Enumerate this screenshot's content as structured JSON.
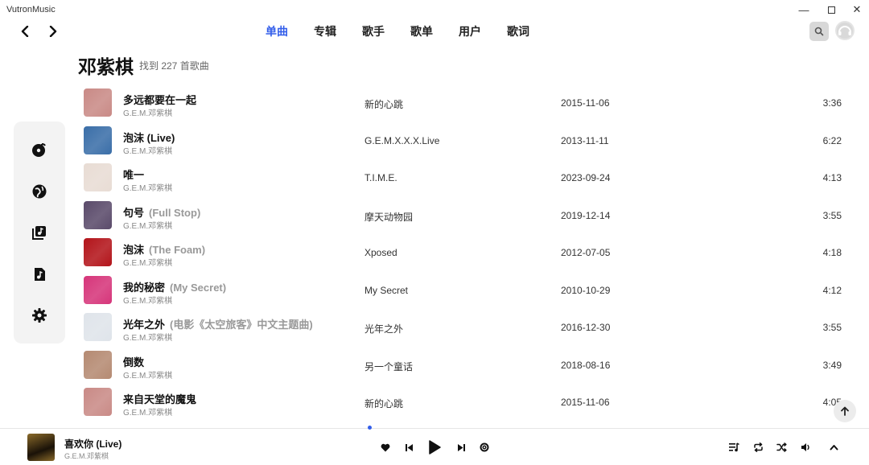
{
  "app": {
    "title": "VutronMusic",
    "window_controls": {
      "minimize": "—",
      "maximize_icon": "maximize-icon",
      "close": "✕"
    }
  },
  "nav": {
    "back_icon": "chevron-left-icon",
    "forward_icon": "chevron-right-icon"
  },
  "tabs": [
    {
      "label": "单曲",
      "active": true
    },
    {
      "label": "专辑",
      "active": false
    },
    {
      "label": "歌手",
      "active": false
    },
    {
      "label": "歌单",
      "active": false
    },
    {
      "label": "用户",
      "active": false
    },
    {
      "label": "歌词",
      "active": false
    }
  ],
  "header": {
    "search_icon": "search-icon",
    "avatar_icon": "user-avatar-icon"
  },
  "page": {
    "artist": "邓紫棋",
    "result_count": "找到 227 首歌曲"
  },
  "sidebar": {
    "items": [
      {
        "icon": "music-disc-icon"
      },
      {
        "icon": "explore-globe-icon"
      },
      {
        "icon": "library-icon"
      },
      {
        "icon": "music-folder-icon"
      },
      {
        "icon": "settings-gear-icon"
      }
    ]
  },
  "songs": [
    {
      "title": "多远都要在一起",
      "subtitle": "",
      "artist": "G.E.M.邓紫棋",
      "album": "新的心跳",
      "date": "2015-11-06",
      "duration": "3:36",
      "cover_color": "#c98a86"
    },
    {
      "title": "泡沫 (Live)",
      "subtitle": "",
      "artist": "G.E.M.邓紫棋",
      "album": "G.E.M.X.X.X.Live",
      "date": "2013-11-11",
      "duration": "6:22",
      "cover_color": "#3a6ea8"
    },
    {
      "title": "唯一",
      "subtitle": "",
      "artist": "G.E.M.邓紫棋",
      "album": "T.I.M.E.",
      "date": "2023-09-24",
      "duration": "4:13",
      "cover_color": "#e8dcd4"
    },
    {
      "title": "句号",
      "subtitle": "(Full Stop)",
      "artist": "G.E.M.邓紫棋",
      "album": "摩天动物园",
      "date": "2019-12-14",
      "duration": "3:55",
      "cover_color": "#5a4a6a"
    },
    {
      "title": "泡沫",
      "subtitle": "(The Foam)",
      "artist": "G.E.M.邓紫棋",
      "album": "Xposed",
      "date": "2012-07-05",
      "duration": "4:18",
      "cover_color": "#b3141a"
    },
    {
      "title": "我的秘密",
      "subtitle": "(My Secret)",
      "artist": "G.E.M.邓紫棋",
      "album": "My Secret",
      "date": "2010-10-29",
      "duration": "4:12",
      "cover_color": "#d6357a"
    },
    {
      "title": "光年之外",
      "subtitle": "(电影《太空旅客》中文主题曲)",
      "artist": "G.E.M.邓紫棋",
      "album": "光年之外",
      "date": "2016-12-30",
      "duration": "3:55",
      "cover_color": "#dfe4ea"
    },
    {
      "title": "倒数",
      "subtitle": "",
      "artist": "G.E.M.邓紫棋",
      "album": "另一个童话",
      "date": "2018-08-16",
      "duration": "3:49",
      "cover_color": "#b58a72"
    },
    {
      "title": "来自天堂的魔鬼",
      "subtitle": "",
      "artist": "G.E.M.邓紫棋",
      "album": "新的心跳",
      "date": "2015-11-06",
      "duration": "4:05",
      "cover_color": "#c98a86"
    }
  ],
  "scroll_top_icon": "arrow-up-icon",
  "player": {
    "title": "喜欢你 (Live)",
    "artist": "G.E.M.邓紫棋",
    "cover_color": "#8a6a2a",
    "controls": [
      "heart-icon",
      "previous-icon",
      "play-icon",
      "next-icon",
      "fm-icon"
    ],
    "right_controls": [
      "playlist-icon",
      "repeat-icon",
      "shuffle-icon",
      "volume-icon",
      "chevron-up-icon"
    ],
    "accent": "#335eea"
  }
}
